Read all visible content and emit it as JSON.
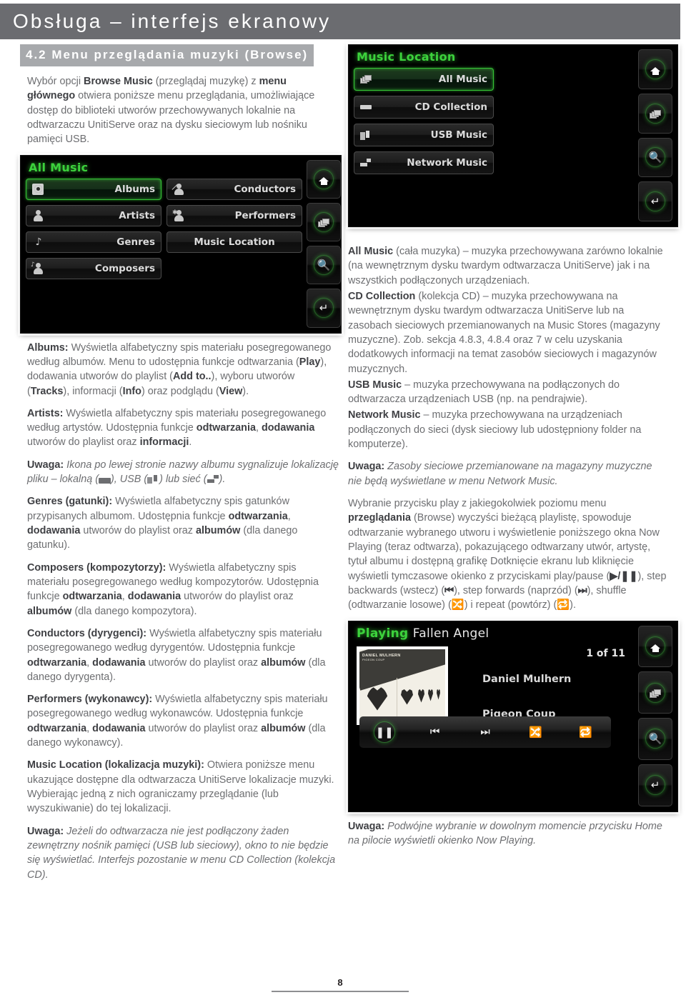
{
  "header": {
    "title": "Obsługa – interfejs ekranowy"
  },
  "section": {
    "heading": "4.2 Menu przeglądania muzyki (Browse)"
  },
  "intro": {
    "paragraph": "Wybór opcji Browse Music (przeglądaj muzykę) z menu głównego otwiera poniższe menu przeglądania, umożliwiające dostęp do biblioteki utworów przechowywanych lokalnie na odtwarzaczu UnitiServe oraz na dysku sieciowym lub nośniku pamięci USB."
  },
  "screens": {
    "all_music": {
      "name": "all-music-screen",
      "title": "All Music",
      "buttons_left": [
        {
          "label": "Albums",
          "icon": "disc-icon",
          "selected": true
        },
        {
          "label": "Artists",
          "icon": "person-icon",
          "selected": false
        },
        {
          "label": "Genres",
          "icon": "music-note-icon",
          "selected": false
        },
        {
          "label": "Composers",
          "icon": "person-note-icon",
          "selected": false
        }
      ],
      "buttons_right": [
        {
          "label": "Conductors",
          "icon": "person-baton-icon",
          "selected": false
        },
        {
          "label": "Performers",
          "icon": "person-star-icon",
          "selected": false
        },
        {
          "label": "Music Location",
          "icon": "none",
          "selected": false
        }
      ],
      "side_keys": [
        "home-icon",
        "stack-icon",
        "search-icon",
        "enter-icon"
      ]
    },
    "music_location": {
      "name": "music-location-screen",
      "title": "Music Location",
      "buttons": [
        {
          "label": "All Music",
          "icon": "stack-icon",
          "selected": true
        },
        {
          "label": "CD Collection",
          "icon": "local-disk-icon",
          "selected": false
        },
        {
          "label": "USB Music",
          "icon": "usb-icon",
          "selected": false
        },
        {
          "label": "Network Music",
          "icon": "network-icon",
          "selected": false
        }
      ],
      "side_keys": [
        "home-icon",
        "stack-icon",
        "search-icon",
        "enter-icon"
      ]
    },
    "now_playing": {
      "name": "now-playing-screen",
      "status": "Playing",
      "track": "Fallen Angel",
      "counter": "1 of 11",
      "artist": "Daniel Mulhern",
      "album": "Pigeon Coup",
      "artwork_credit": "DANIEL MULHERN",
      "artwork_credit_sub": "PIGEON COUP",
      "transport": [
        "pause-icon",
        "step-backward-icon",
        "step-forward-icon",
        "shuffle-icon",
        "repeat-icon"
      ],
      "side_keys": [
        "home-icon",
        "stack-icon",
        "search-icon",
        "enter-icon"
      ]
    }
  },
  "left_column": {
    "albums": {
      "term": "Albums:",
      "body_1": " Wyświetla alfabetyczny spis materiału posegregowanego według albumów. Menu to udostępnia funkcje odtwarzania (",
      "b_play": "Play",
      "body_2": "), dodawania utworów do playlist (",
      "b_addto": "Add to..",
      "body_3": "), wyboru utworów (",
      "b_tracks": "Tracks",
      "body_4": "), informacji (",
      "b_info": "Info",
      "body_5": ") oraz podglądu (",
      "b_view": "View",
      "body_6": ")."
    },
    "artists": {
      "term": "Artists:",
      "body_1": " Wyświetla alfabetyczny spis materiału posegregowanego według artystów. Udostępnia funkcje ",
      "b_1": "odtwarzania",
      "body_2": ", ",
      "b_2": "dodawania",
      "body_3": " utworów do playlist oraz ",
      "b_3": "informacji",
      "body_4": "."
    },
    "note_icons": {
      "term": "Uwaga:",
      "body_1": " Ikona po lewej stronie nazwy albumu sygnalizuje lokalizację pliku – lokalną (",
      "body_2": "), USB (",
      "body_3": ") lub sieć (",
      "body_4": ")."
    },
    "genres": {
      "term": "Genres (gatunki):",
      "body_1": " Wyświetla alfabetyczny spis gatunków przypisanych albumom. Udostępnia funkcje ",
      "b_1": "odtwarzania",
      "body_2": ", ",
      "b_2": "dodawania",
      "body_3": " utworów do playlist oraz ",
      "b_3": "albumów",
      "body_4": " (dla danego gatunku)."
    },
    "composers": {
      "term": "Composers (kompozytorzy):",
      "body_1": " Wyświetla alfabetyczny spis materiału posegregowanego według kompozytorów. Udostępnia funkcje ",
      "b_1": "odtwarzania",
      "body_2": ", ",
      "b_2": "dodawania",
      "body_3": " utworów do playlist oraz ",
      "b_3": "albumów",
      "body_4": " (dla danego kompozytora)."
    },
    "conductors": {
      "term": "Conductors (dyrygenci):",
      "body_1": " Wyświetla alfabetyczny spis materiału posegregowanego według dyrygentów. Udostępnia funkcje ",
      "b_1": "odtwarzania",
      "body_2": ", ",
      "b_2": "dodawania",
      "body_3": " utworów do playlist oraz ",
      "b_3": "albumów",
      "body_4": " (dla danego dyrygenta)."
    },
    "performers": {
      "term": "Performers (wykonawcy):",
      "body_1": " Wyświetla alfabetyczny spis materiału posegregowanego według wykonawców. Udostępnia funkcje ",
      "b_1": "odtwarzania",
      "body_2": ", ",
      "b_2": "dodawania",
      "body_3": " utworów do playlist oraz ",
      "b_3": "albumów",
      "body_4": " (dla danego wykonawcy)."
    },
    "music_location": {
      "term": "Music Location (lokalizacja muzyki):",
      "body_1": " Otwiera poniższe menu ukazujące dostępne dla odtwarzacza UnitiServe lokalizacje muzyki. Wybierając jedną z nich ograniczamy przeglądanie (lub wyszukiwanie) do tej lokalizacji."
    },
    "note_cd": {
      "term": "Uwaga:",
      "body_1": " Jeżeli do odtwarzacza nie jest podłączony żaden zewnętrzny nośnik pamięci (USB lub sieciowy), okno to nie będzie się wyświetlać. Interfejs pozostanie w menu CD Collection (kolekcja CD)."
    }
  },
  "right_column": {
    "all_music": {
      "term": "All Music",
      "body": " (cała muzyka) – muzyka przechowywana zarówno lokalnie (na wewnętrznym dysku twardym odtwarzacza UnitiServe) jak i na wszystkich podłączonych urządzeniach."
    },
    "cd_collection": {
      "term": "CD Collection",
      "body": " (kolekcja CD) – muzyka przechowywana na wewnętrznym dysku twardym odtwarzacza UnitiServe lub na zasobach sieciowych przemianowanych na Music Stores (magazyny muzyczne). Zob. sekcja 4.8.3, 4.8.4 oraz 7 w celu uzyskania dodatkowych informacji na temat zasobów sieciowych i magazynów muzycznych."
    },
    "usb_music": {
      "term": "USB Music",
      "body": " – muzyka przechowywana na podłączonych do odtwarzacza urządzeniach USB (np. na pendrajwie)."
    },
    "network_music": {
      "term": "Network Music",
      "body": " – muzyka przechowywana na urządzeniach podłączonych do sieci (dysk sieciowy lub udostępniony folder na komputerze)."
    },
    "note_network": {
      "term": "Uwaga:",
      "body": " Zasoby sieciowe przemianowane na magazyny muzyczne nie będą wyświetlane w menu Network Music."
    },
    "play_desc": {
      "body_1": "Wybranie przycisku play z jakiegokolwiek poziomu menu ",
      "b_1": "przeglądania",
      "body_2": " (Browse) wyczyści bieżącą playlistę, spowoduje odtwarzanie wybranego utworu i wyświetlenie poniższego okna Now Playing (teraz odtwarza), pokazującego odtwarzany utwór, artystę, tytuł albumu i dostępną grafikę Dotknięcie ekranu lub kliknięcie wyświetli tymczasowe okienko z przyciskami play/pause (",
      "body_3": "), step backwards (wstecz) (",
      "body_4": "), step forwards (naprzód) (",
      "body_5": "), shuffle (odtwarzanie losowe) (",
      "body_6": ") i repeat (powtórz) (",
      "body_7": ")."
    },
    "note_home": {
      "term": "Uwaga:",
      "body": " Podwójne wybranie w dowolnym momencie przycisku Home na pilocie wyświetli okienko Now Playing."
    }
  },
  "footer": {
    "page_number": "8"
  },
  "colors": {
    "header_bar": "#6b6c70",
    "section_bar": "#a7a9ac",
    "body_text": "#6d6e71",
    "bold_text": "#3f4044",
    "screen_green": "#3cd23c",
    "screen_bg": "#000000"
  }
}
